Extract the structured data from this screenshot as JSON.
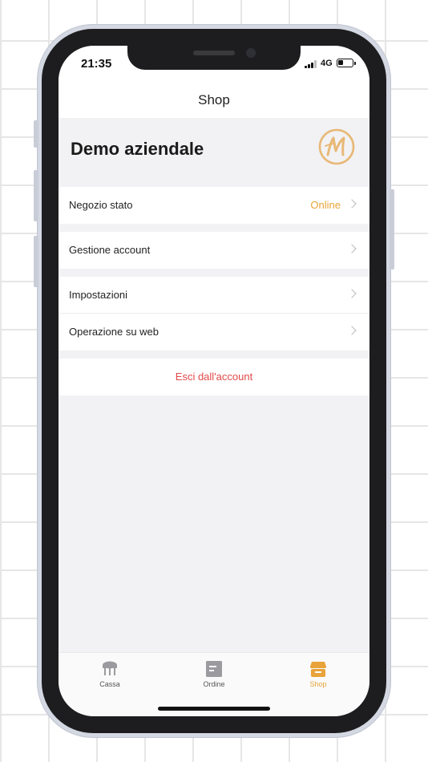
{
  "status_bar": {
    "time": "21:35",
    "network": "4G"
  },
  "nav": {
    "title": "Shop"
  },
  "shop": {
    "name": "Demo aziendale",
    "logo_icon": "brand-m-logo"
  },
  "menu": {
    "group1": [
      {
        "label": "Negozio stato",
        "value": "Online"
      }
    ],
    "group2": [
      {
        "label": "Gestione account"
      }
    ],
    "group3": [
      {
        "label": "Impostazioni"
      },
      {
        "label": "Operazione su web"
      }
    ]
  },
  "logout": {
    "label": "Esci dall'account"
  },
  "tabs": [
    {
      "label": "Cassa",
      "icon": "cash-register-icon",
      "active": false
    },
    {
      "label": "Ordine",
      "icon": "order-icon",
      "active": false
    },
    {
      "label": "Shop",
      "icon": "shop-icon",
      "active": true
    }
  ],
  "colors": {
    "accent": "#e8a33a",
    "danger": "#e3494a",
    "background": "#f2f2f4",
    "inactive_icon": "#9b9b9f"
  }
}
